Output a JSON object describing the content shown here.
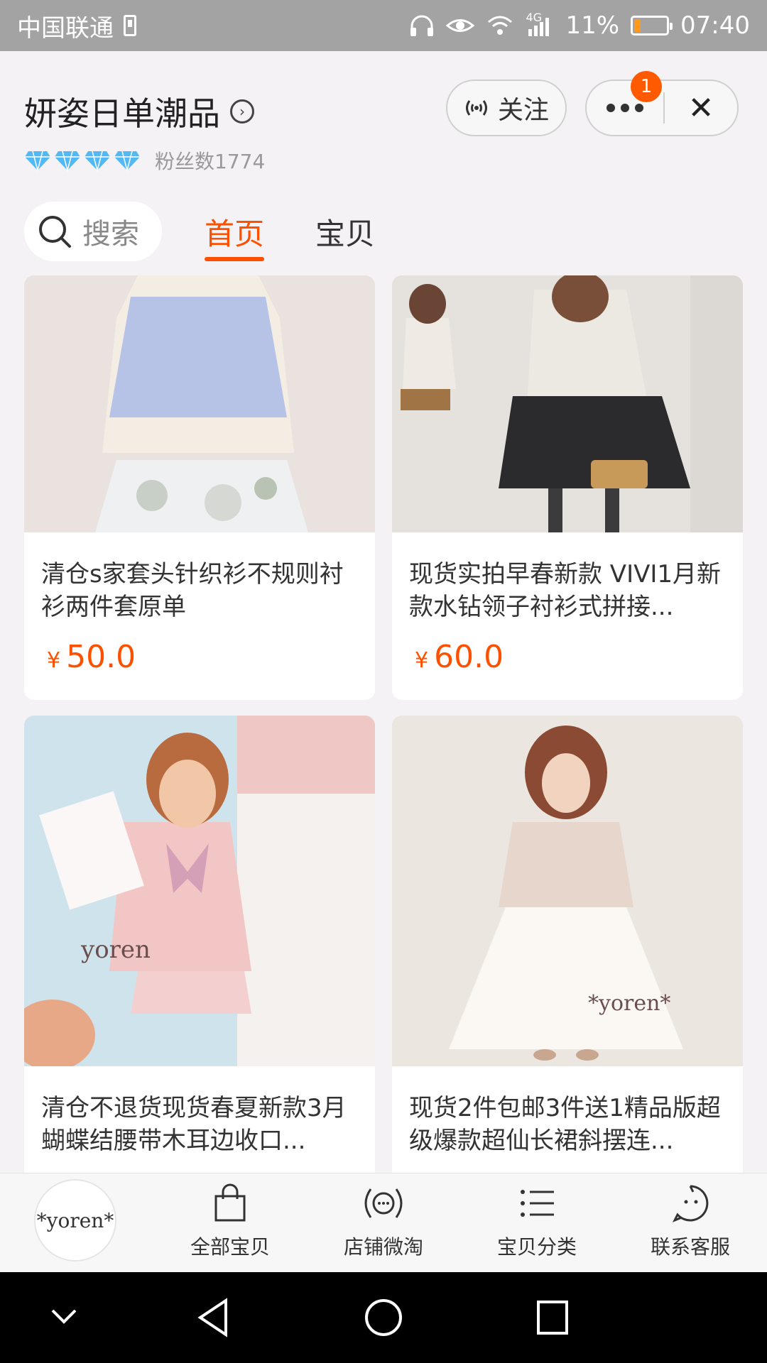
{
  "status_bar": {
    "carrier": "中国联通",
    "network": "4G",
    "battery_percent": "11%",
    "time": "07:40"
  },
  "header": {
    "shop_name": "妍姿日单潮品",
    "fans_label": "粉丝数1774",
    "follow_label": "关注",
    "menu_badge": "1",
    "close_glyph": "✕"
  },
  "search": {
    "label": "搜索"
  },
  "tabs": [
    {
      "label": "首页",
      "active": true
    },
    {
      "label": "宝贝",
      "active": false
    }
  ],
  "products": [
    {
      "title": "清仓s家套头针织衫不规则衬衫两件套原单",
      "currency": "¥",
      "price": "50.0"
    },
    {
      "title": "现货实拍早春新款 VIVI1月新款水钻领子衬衫式拼接...",
      "currency": "¥",
      "price": "60.0"
    },
    {
      "title": "清仓不退货现货春夏新款3月蝴蝶结腰带木耳边收口..."
    },
    {
      "title": "现货2件包邮3件送1精品版超级爆款超仙长裙斜摆连..."
    }
  ],
  "bottom_nav": {
    "logo_text": "*yoren*",
    "items": [
      {
        "label": "全部宝贝",
        "icon": "shopping-bag-icon"
      },
      {
        "label": "店铺微淘",
        "icon": "broadcast-icon"
      },
      {
        "label": "宝贝分类",
        "icon": "list-icon"
      },
      {
        "label": "联系客服",
        "icon": "chat-face-icon"
      }
    ]
  },
  "colors": {
    "accent": "#ff5000",
    "status_bar": "#a3a3a3",
    "background": "#f4f2f5"
  }
}
